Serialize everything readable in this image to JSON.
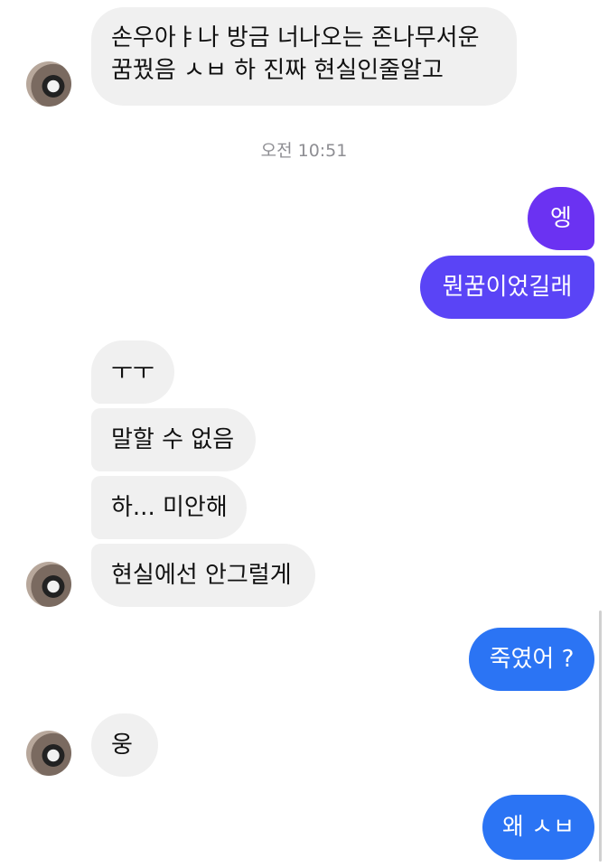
{
  "colors": {
    "incoming_bubble": "#f0f0f0",
    "outgoing_purple": "#6b32f2",
    "outgoing_indigo": "#5a44f6",
    "outgoing_blue": "#2b74f4",
    "timestamp_text": "#8e8e93"
  },
  "timestamp": "오전 10:51",
  "messages": [
    {
      "from": "them",
      "text_lines": [
        "손우아ㅑ나 방금 너나오는 존나무서운",
        "꿈꿨음 ㅅㅂ 하 진짜 현실인줄알고"
      ]
    },
    {
      "from": "me",
      "text": "엥"
    },
    {
      "from": "me",
      "text": "뭔꿈이었길래"
    },
    {
      "from": "them",
      "text": "ㅜㅜ"
    },
    {
      "from": "them",
      "text": "말할 수 없음"
    },
    {
      "from": "them",
      "text": "하... 미안해"
    },
    {
      "from": "them",
      "text": "현실에선 안그럴게"
    },
    {
      "from": "me",
      "text": "죽였어 ?"
    },
    {
      "from": "them",
      "text": "웅"
    },
    {
      "from": "me",
      "text": "왜 ㅅㅂ"
    }
  ],
  "avatar_icon": "cat-avatar-icon"
}
